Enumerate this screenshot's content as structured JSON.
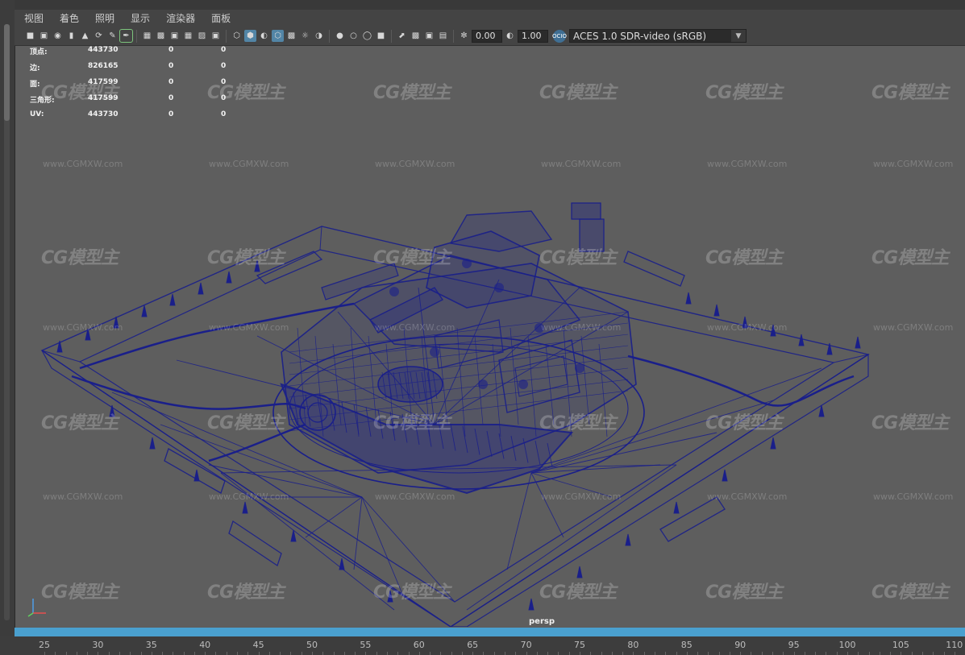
{
  "menu": [
    "视图",
    "着色",
    "照明",
    "显示",
    "渲染器",
    "面板"
  ],
  "toolbar": {
    "exposure": "0.00",
    "gamma": "1.00",
    "color_space": "ACES 1.0 SDR-video (sRGB)",
    "ocio_badge": "OCIO",
    "icons": [
      "camera-icon",
      "camera-attributes-icon",
      "bookmark-icon",
      "image-plane-icon",
      "grid-icon",
      "film-gate-icon",
      "resolution-gate-icon",
      "gate-mask-icon",
      "field-chart-icon",
      "safe-action-icon",
      "wireframe-icon",
      "smooth-shade-icon",
      "default-material-icon",
      "wireframe-on-shaded-icon",
      "textured-icon",
      "use-all-lights-icon",
      "shadows-icon",
      "ambient-occlusion-icon",
      "motion-blur-icon",
      "anti-aliasing-icon",
      "depth-of-field-icon",
      "isolate-select-icon",
      "xray-icon",
      "xray-joints-icon",
      "xray-active-icon",
      "exposure-icon",
      "gamma-icon"
    ]
  },
  "hud": {
    "rows": [
      {
        "label": "顶点:",
        "v1": "443730",
        "v2": "0",
        "v3": "0"
      },
      {
        "label": "边:",
        "v1": "826165",
        "v2": "0",
        "v3": "0"
      },
      {
        "label": "面:",
        "v1": "417599",
        "v2": "0",
        "v3": "0"
      },
      {
        "label": "三角形:",
        "v1": "417599",
        "v2": "0",
        "v3": "0"
      },
      {
        "label": "UV:",
        "v1": "443730",
        "v2": "0",
        "v3": "0"
      }
    ]
  },
  "viewport": {
    "camera_label": "persp",
    "wireframe_color": "#1a1f8a",
    "background_color": "#5e5e5e"
  },
  "watermark": {
    "logo": "CG模型主",
    "url": "www.CGMXW.com"
  },
  "timeline": {
    "ticks": [
      "25",
      "30",
      "35",
      "40",
      "45",
      "50",
      "55",
      "60",
      "65",
      "70",
      "75",
      "80",
      "85",
      "90",
      "95",
      "100",
      "105",
      "110"
    ],
    "slider_color": "#4aa0cf"
  }
}
